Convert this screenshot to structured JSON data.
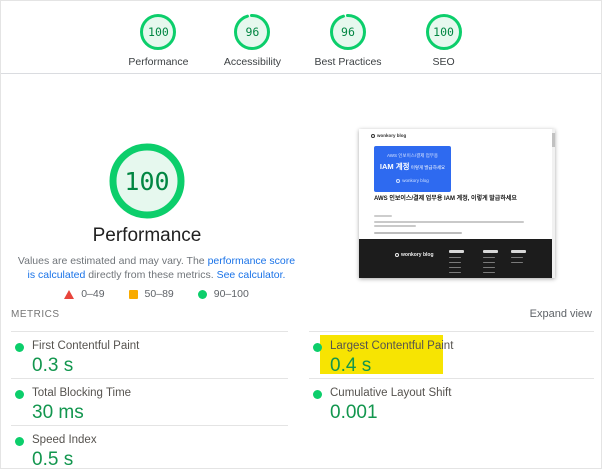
{
  "score_nav": {
    "items": [
      {
        "label": "Performance",
        "score": "100",
        "pct": 100
      },
      {
        "label": "Accessibility",
        "score": "96",
        "pct": 96
      },
      {
        "label": "Best Practices",
        "score": "96",
        "pct": 96
      },
      {
        "label": "SEO",
        "score": "100",
        "pct": 100
      }
    ]
  },
  "summary": {
    "score": "100",
    "pct": 100,
    "title": "Performance",
    "disclaimer_pre": "Values are estimated and may vary. The ",
    "disclaimer_link1": "performance score is calculated",
    "disclaimer_mid": " directly from these metrics. ",
    "disclaimer_link2": "See calculator."
  },
  "legend": {
    "fail": "0–49",
    "average": "50–89",
    "pass": "90–100"
  },
  "metrics_section": {
    "title": "METRICS",
    "expand": "Expand view",
    "left": [
      {
        "label": "First Contentful Paint",
        "value": "0.3 s"
      },
      {
        "label": "Total Blocking Time",
        "value": "30 ms"
      },
      {
        "label": "Speed Index",
        "value": "0.5 s"
      }
    ],
    "right": [
      {
        "label": "Largest Contentful Paint",
        "value": "0.4 s",
        "highlighted": true
      },
      {
        "label": "Cumulative Layout Shift",
        "value": "0.001"
      }
    ]
  },
  "annotation": {
    "highlighted_metric": "Largest Contentful Paint",
    "highlight_color": "#f7e402"
  },
  "thumbnail": {
    "site_name": "wonkory blog",
    "card_line1": "AWS 인보이스/결제 업무용",
    "card_line2_strong": "IAM 계정",
    "card_line2_rest": " 이렇게 발급하세요",
    "card_brand": "wonkory blog",
    "post_title": "AWS 인보이스/결제 업무용 IAM 계정, 이렇게 발급하세요",
    "footer_brand": "wonkory blog"
  },
  "colors": {
    "gauge_ring_green": "#0cce6b",
    "gauge_fill_green": "#e6f8ee",
    "score_text_green": "#018642",
    "metric_value_green": "#12964e",
    "link_blue": "#1a73e8",
    "legend_red": "#e8453c",
    "legend_orange": "#f9ab00",
    "thumb_card_blue": "#2e6af0"
  }
}
